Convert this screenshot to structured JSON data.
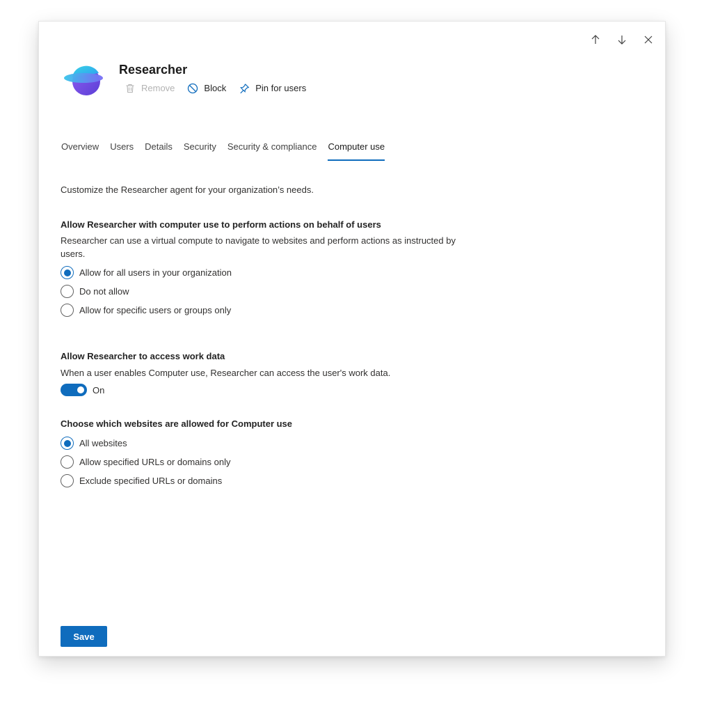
{
  "app": {
    "title": "Researcher",
    "logo_icon": "researcher-logo"
  },
  "window_controls": {
    "icons": [
      "arrow-up-icon",
      "arrow-down-icon",
      "close-icon"
    ]
  },
  "actions": {
    "remove_label": "Remove",
    "block_label": "Block",
    "pin_label": "Pin for users"
  },
  "tabs": [
    {
      "label": "Overview",
      "active": false
    },
    {
      "label": "Users",
      "active": false
    },
    {
      "label": "Details",
      "active": false
    },
    {
      "label": "Security",
      "active": false
    },
    {
      "label": "Security & compliance",
      "active": false
    },
    {
      "label": "Computer use",
      "active": true
    }
  ],
  "intro": "Customize the Researcher agent for your organization’s needs.",
  "computer_use_section": {
    "title": "Allow Researcher with computer use to perform actions on behalf of users",
    "description": "Researcher can use a virtual compute to navigate to websites and perform actions as instructed by users.",
    "options": [
      {
        "label": "Allow for all users in your organization",
        "checked": true
      },
      {
        "label": "Do not allow",
        "checked": false
      },
      {
        "label": "Allow for specific users or groups only",
        "checked": false
      }
    ]
  },
  "work_data_section": {
    "title": "Allow Researcher to access work data",
    "description": "When a user enables Computer use, Researcher can access the user's work data.",
    "toggle_state": "On"
  },
  "websites_section": {
    "title": "Choose which websites are allowed for Computer use",
    "options": [
      {
        "label": "All websites",
        "checked": true
      },
      {
        "label": "Allow specified URLs or domains only",
        "checked": false
      },
      {
        "label": "Exclude specified URLs or domains",
        "checked": false
      }
    ]
  },
  "save_label": "Save",
  "colors": {
    "accent": "#0f6cbd",
    "text": "#242424",
    "disabled": "#b3b3b3"
  }
}
